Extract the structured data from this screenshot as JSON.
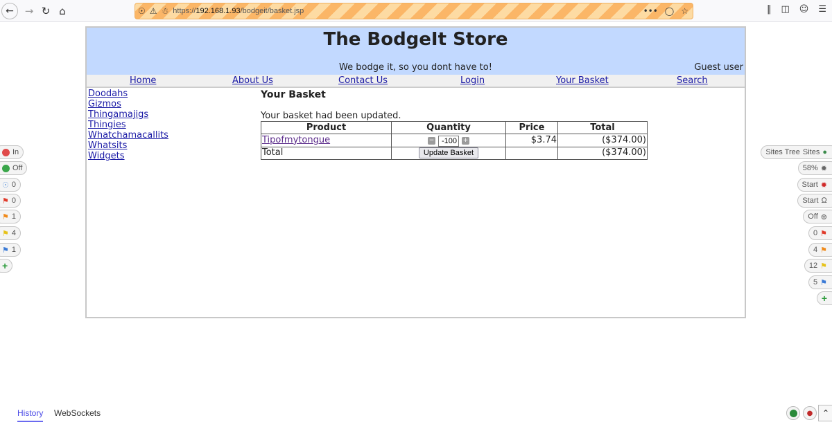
{
  "browser": {
    "url_scheme": "https://",
    "url_host": "192.168.1.93",
    "url_path": "/bodgeit/basket.jsp",
    "more_label": "•••"
  },
  "header": {
    "title": "The BodgeIt Store",
    "tagline": "We bodge it, so you dont have to!",
    "user": "Guest user"
  },
  "nav": {
    "home": "Home",
    "about": "About Us",
    "contact": "Contact Us",
    "login": "Login",
    "basket": "Your Basket",
    "search": "Search"
  },
  "sidebar": {
    "items": [
      "Doodahs",
      "Gizmos",
      "Thingamajigs",
      "Thingies",
      "Whatchamacallits",
      "Whatsits",
      "Widgets"
    ]
  },
  "basket": {
    "heading": "Your Basket",
    "message": "Your basket had been updated.",
    "columns": [
      "Product",
      "Quantity",
      "Price",
      "Total"
    ],
    "row": {
      "product": "Tipofmytongue",
      "quantity": "-100",
      "price": "$3.74",
      "total": "($374.00)"
    },
    "total_label": "Total",
    "update_button": "Update Basket",
    "grand_total": "($374.00)"
  },
  "zap_left": [
    {
      "icon": "red-circle",
      "label": "In",
      "color": "#e04a4a"
    },
    {
      "icon": "green-circle",
      "label": "Off",
      "color": "#3aa64a"
    },
    {
      "icon": "bulb",
      "label": "0"
    },
    {
      "icon": "red-flag",
      "label": "0",
      "color": "#e03a2a"
    },
    {
      "icon": "orange-flag",
      "label": "1",
      "color": "#f08a1a"
    },
    {
      "icon": "yellow-flag",
      "label": "4",
      "color": "#e6c21a"
    },
    {
      "icon": "blue-flag",
      "label": "1",
      "color": "#3a7ad6"
    }
  ],
  "zap_right": {
    "sites_tree": "Sites Tree",
    "sites": "Sites",
    "progress": "58%",
    "start_spider": "Start",
    "start_ajax": "Start",
    "off": "Off",
    "red_count": "0",
    "orange_count": "4",
    "yellow_count": "12",
    "blue_count": "5"
  },
  "bottom": {
    "history_tab": "History",
    "websockets_tab": "WebSockets"
  }
}
